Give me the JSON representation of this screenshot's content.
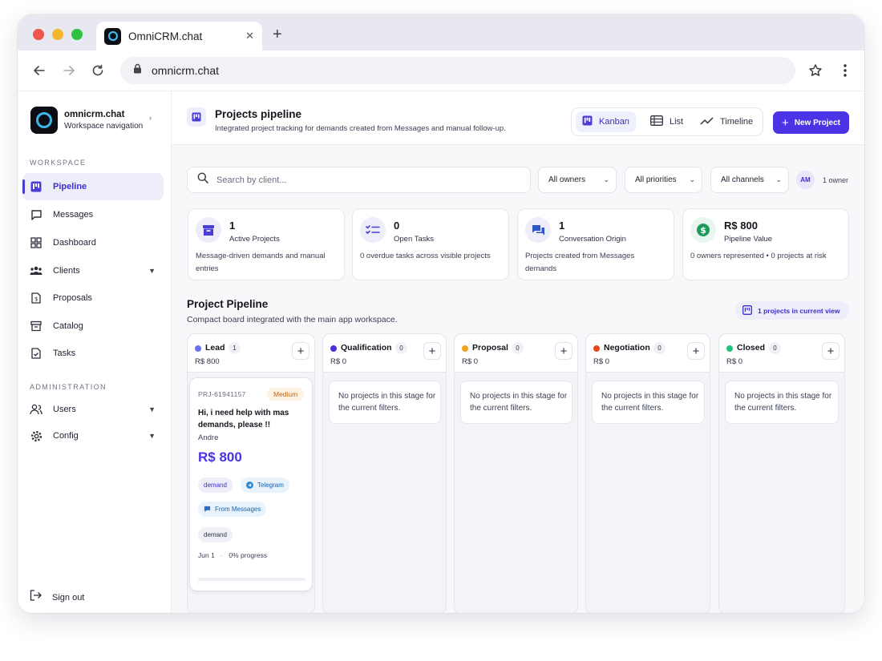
{
  "browser": {
    "tab_title": "OmniCRM.chat",
    "url": "omnicrm.chat"
  },
  "sidebar": {
    "brand_name": "omnicrm.chat",
    "brand_sub": "Workspace navigation",
    "workspace_label": "WORKSPACE",
    "admin_label": "ADMINISTRATION",
    "items": [
      {
        "label": "Pipeline",
        "icon": "kanban-icon"
      },
      {
        "label": "Messages",
        "icon": "message-icon"
      },
      {
        "label": "Dashboard",
        "icon": "dashboard-icon"
      },
      {
        "label": "Clients",
        "icon": "clients-icon"
      },
      {
        "label": "Proposals",
        "icon": "proposal-icon"
      },
      {
        "label": "Catalog",
        "icon": "catalog-icon"
      },
      {
        "label": "Tasks",
        "icon": "tasks-icon"
      }
    ],
    "admin_items": [
      {
        "label": "Users",
        "icon": "users-icon"
      },
      {
        "label": "Config",
        "icon": "gear-icon"
      }
    ],
    "signout": "Sign out"
  },
  "header": {
    "title": "Projects pipeline",
    "subtitle": "Integrated project tracking for demands created from Messages and manual follow-up.",
    "views": [
      "Kanban",
      "List",
      "Timeline"
    ],
    "new_project": "New Project"
  },
  "filters": {
    "search_placeholder": "Search by client...",
    "owners": "All owners",
    "priorities": "All priorities",
    "channels": "All channels",
    "avatar": "AM",
    "owner_count": "1 owner"
  },
  "stats": [
    {
      "value": "1",
      "label": "Active Projects",
      "desc": "Message-driven demands and manual entries"
    },
    {
      "value": "0",
      "label": "Open Tasks",
      "desc": "0 overdue tasks across visible projects"
    },
    {
      "value": "1",
      "label": "Conversation Origin",
      "desc": "Projects created from Messages demands"
    },
    {
      "value": "R$ 800",
      "label": "Pipeline Value",
      "desc": "0 owners represented • 0 projects at risk"
    }
  ],
  "pipeline": {
    "title": "Project Pipeline",
    "subtitle": "Compact board integrated with the main app workspace.",
    "view_badge": "1 projects in current view",
    "empty_text": "No projects in this stage for the current filters.",
    "stages": [
      {
        "name": "Lead",
        "count": "1",
        "total": "R$ 800",
        "color": "#6b73e8"
      },
      {
        "name": "Qualification",
        "count": "0",
        "total": "R$ 0",
        "color": "#4a2ee0"
      },
      {
        "name": "Proposal",
        "count": "0",
        "total": "R$ 0",
        "color": "#f0a21b"
      },
      {
        "name": "Negotiation",
        "count": "0",
        "total": "R$ 0",
        "color": "#e8481c"
      },
      {
        "name": "Closed",
        "count": "0",
        "total": "R$ 0",
        "color": "#1fc47a"
      }
    ]
  },
  "card": {
    "id": "PRJ-61941157",
    "priority": "Medium",
    "title": "Hi, i need help with mas demands, please !!",
    "client": "Andre",
    "value": "R$ 800",
    "tags": [
      "demand",
      "Telegram",
      "From Messages",
      "demand"
    ],
    "date": "Jun 1",
    "separator": "·",
    "progress_label": "0% progress",
    "progress": 0
  },
  "colors": {
    "accent": "#4b33e6",
    "accent_soft": "#eeeefa"
  }
}
